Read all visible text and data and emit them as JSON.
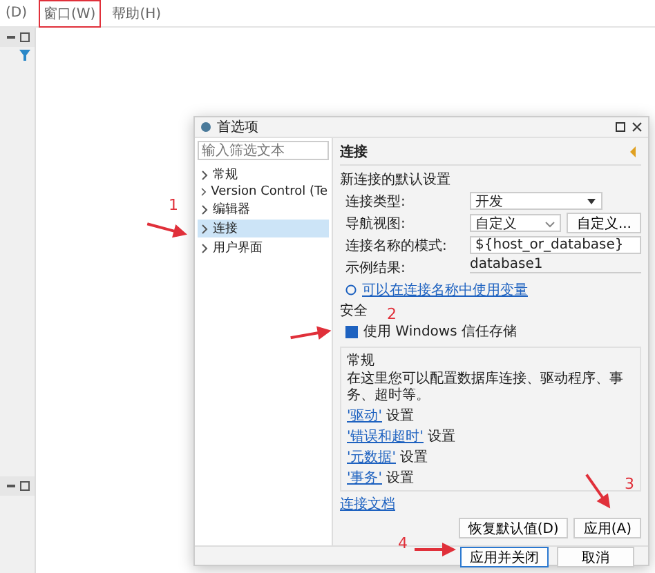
{
  "menu_bar": {
    "items": [
      {
        "label": "(D)",
        "highlighted": false
      },
      {
        "label": "窗口(W)",
        "highlighted": true
      },
      {
        "label": "帮助(H)",
        "highlighted": false
      }
    ]
  },
  "dialog": {
    "title": "首选项",
    "filter": {
      "placeholder": "输入筛选文本"
    },
    "nav": [
      {
        "label": "常规",
        "selected": false
      },
      {
        "label": "Version Control (Te",
        "selected": false
      },
      {
        "label": "编辑器",
        "selected": false
      },
      {
        "label": "连接",
        "selected": true
      },
      {
        "label": "用户界面",
        "selected": false
      }
    ],
    "page_title": "连接",
    "defaults_heading": "新连接的默认设置",
    "fields": [
      {
        "kind": "select",
        "label": "连接类型:",
        "value": "开发"
      },
      {
        "kind": "combo",
        "label": "导航视图:",
        "value": "自定义",
        "button": "自定义..."
      },
      {
        "kind": "input",
        "label": "连接名称的模式:",
        "value": "${host_or_database}"
      },
      {
        "kind": "text",
        "label": "示例结果:",
        "value": "database1"
      }
    ],
    "variables_link": "可以在连接名称中使用变量",
    "security_heading": "安全",
    "trust_store": {
      "label": "使用 Windows 信任存储",
      "checked": true
    },
    "general": {
      "title": "常规",
      "description": "在这里您可以配置数据库连接、驱动程序、事务、超时等。",
      "links": [
        {
          "link": "'驱动'",
          "suffix": "设置"
        },
        {
          "link": "'错误和超时'",
          "suffix": "设置"
        },
        {
          "link": "'元数据'",
          "suffix": "设置"
        },
        {
          "link": "'事务'",
          "suffix": "设置"
        }
      ]
    },
    "docs_link": "连接文档",
    "buttons": [
      "恢复默认值(D)",
      "应用(A)"
    ],
    "footer_buttons": [
      {
        "label": "应用并关闭",
        "focused": true
      },
      {
        "label": "取消",
        "focused": false
      }
    ]
  },
  "annotations": [
    "1",
    "2",
    "3",
    "4"
  ]
}
